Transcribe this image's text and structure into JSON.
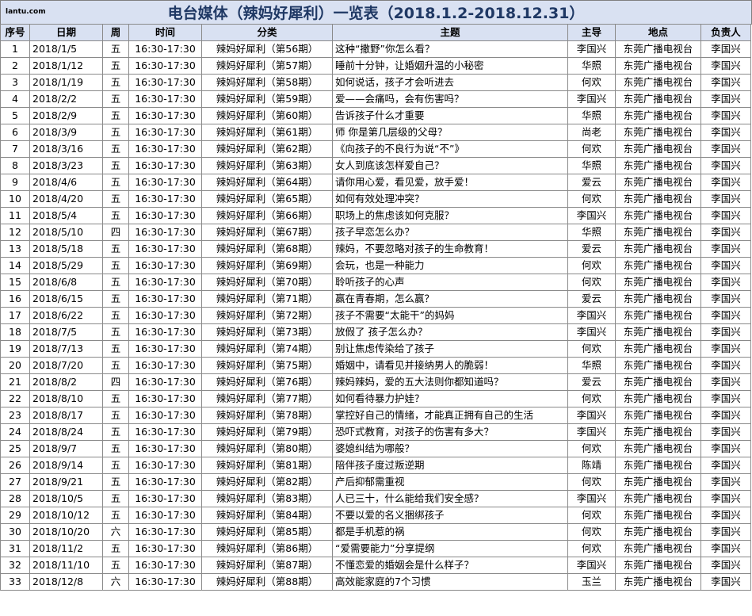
{
  "logo": "lantu.com",
  "title": "电台媒体（辣妈好犀利）一览表（2018.1.2-2018.12.31）",
  "columns": [
    "序号",
    "日期",
    "周",
    "时间",
    "分类",
    "主题",
    "主导",
    "地点",
    "负责人"
  ],
  "rows": [
    [
      "1",
      "2018/1/5",
      "五",
      "16:30-17:30",
      "辣妈好犀利（第56期）",
      "这种“撒野”你怎么看？",
      "李国兴",
      "东莞广播电视台",
      "李国兴"
    ],
    [
      "2",
      "2018/1/12",
      "五",
      "16:30-17:30",
      "辣妈好犀利（第57期）",
      "睡前十分钟，让婚姻升温的小秘密",
      "华照",
      "东莞广播电视台",
      "李国兴"
    ],
    [
      "3",
      "2018/1/19",
      "五",
      "16:30-17:30",
      "辣妈好犀利（第58期）",
      "如何说话，孩子才会听进去",
      "何欢",
      "东莞广播电视台",
      "李国兴"
    ],
    [
      "4",
      "2018/2/2",
      "五",
      "16:30-17:30",
      "辣妈好犀利（第59期）",
      "爱——会痛吗，会有伤害吗？",
      "李国兴",
      "东莞广播电视台",
      "李国兴"
    ],
    [
      "5",
      "2018/2/9",
      "五",
      "16:30-17:30",
      "辣妈好犀利（第60期）",
      "告诉孩子什么才重要",
      "华照",
      "东莞广播电视台",
      "李国兴"
    ],
    [
      "6",
      "2018/3/9",
      "五",
      "16:30-17:30",
      "辣妈好犀利（第61期）",
      "师 你是第几层级的父母？",
      "尚老",
      "东莞广播电视台",
      "李国兴"
    ],
    [
      "7",
      "2018/3/16",
      "五",
      "16:30-17:30",
      "辣妈好犀利（第62期）",
      "《向孩子的不良行为说“不”》",
      "何欢",
      "东莞广播电视台",
      "李国兴"
    ],
    [
      "8",
      "2018/3/23",
      "五",
      "16:30-17:30",
      "辣妈好犀利（第63期）",
      "女人到底该怎样爱自己？",
      "华照",
      "东莞广播电视台",
      "李国兴"
    ],
    [
      "9",
      "2018/4/6",
      "五",
      "16:30-17:30",
      "辣妈好犀利（第64期）",
      "请你用心爱，看见爱，放手爱！",
      "爱云",
      "东莞广播电视台",
      "李国兴"
    ],
    [
      "10",
      "2018/4/20",
      "五",
      "16:30-17:30",
      "辣妈好犀利（第65期）",
      "如何有效处理冲突？",
      "何欢",
      "东莞广播电视台",
      "李国兴"
    ],
    [
      "11",
      "2018/5/4",
      "五",
      "16:30-17:30",
      "辣妈好犀利（第66期）",
      "职场上的焦虑该如何克服？",
      "李国兴",
      "东莞广播电视台",
      "李国兴"
    ],
    [
      "12",
      "2018/5/10",
      "四",
      "16:30-17:30",
      "辣妈好犀利（第67期）",
      "孩子早恋怎么办？",
      "华照",
      "东莞广播电视台",
      "李国兴"
    ],
    [
      "13",
      "2018/5/18",
      "五",
      "16:30-17:30",
      "辣妈好犀利（第68期）",
      "辣妈，不要忽略对孩子的生命教育！",
      "爱云",
      "东莞广播电视台",
      "李国兴"
    ],
    [
      "14",
      "2018/5/29",
      "五",
      "16:30-17:30",
      "辣妈好犀利（第69期）",
      "会玩，也是一种能力",
      "何欢",
      "东莞广播电视台",
      "李国兴"
    ],
    [
      "15",
      "2018/6/8",
      "五",
      "16:30-17:30",
      "辣妈好犀利（第70期）",
      "聆听孩子的心声",
      "何欢",
      "东莞广播电视台",
      "李国兴"
    ],
    [
      "16",
      "2018/6/15",
      "五",
      "16:30-17:30",
      "辣妈好犀利（第71期）",
      "赢在青春期，怎么赢？",
      "爱云",
      "东莞广播电视台",
      "李国兴"
    ],
    [
      "17",
      "2018/6/22",
      "五",
      "16:30-17:30",
      "辣妈好犀利（第72期）",
      "孩子不需要“太能干”的妈妈",
      "李国兴",
      "东莞广播电视台",
      "李国兴"
    ],
    [
      "18",
      "2018/7/5",
      "五",
      "16:30-17:30",
      "辣妈好犀利（第73期）",
      "放假了 孩子怎么办？",
      "李国兴",
      "东莞广播电视台",
      "李国兴"
    ],
    [
      "19",
      "2018/7/13",
      "五",
      "16:30-17:30",
      "辣妈好犀利（第74期）",
      "别让焦虑传染给了孩子",
      "何欢",
      "东莞广播电视台",
      "李国兴"
    ],
    [
      "20",
      "2018/7/20",
      "五",
      "16:30-17:30",
      "辣妈好犀利（第75期）",
      "婚姻中，请看见并接纳男人的脆弱！",
      "华照",
      "东莞广播电视台",
      "李国兴"
    ],
    [
      "21",
      "2018/8/2",
      "四",
      "16:30-17:30",
      "辣妈好犀利（第76期）",
      "辣妈辣妈，爱的五大法则你都知道吗？",
      "爱云",
      "东莞广播电视台",
      "李国兴"
    ],
    [
      "22",
      "2018/8/10",
      "五",
      "16:30-17:30",
      "辣妈好犀利（第77期）",
      "如何看待暴力护娃？",
      "何欢",
      "东莞广播电视台",
      "李国兴"
    ],
    [
      "23",
      "2018/8/17",
      "五",
      "16:30-17:30",
      "辣妈好犀利（第78期）",
      "掌控好自己的情绪，才能真正拥有自己的生活",
      "李国兴",
      "东莞广播电视台",
      "李国兴"
    ],
    [
      "24",
      "2018/8/24",
      "五",
      "16:30-17:30",
      "辣妈好犀利（第79期）",
      "恐吓式教育，对孩子的伤害有多大？",
      "李国兴",
      "东莞广播电视台",
      "李国兴"
    ],
    [
      "25",
      "2018/9/7",
      "五",
      "16:30-17:30",
      "辣妈好犀利（第80期）",
      "婆媳纠结为哪般？",
      "何欢",
      "东莞广播电视台",
      "李国兴"
    ],
    [
      "26",
      "2018/9/14",
      "五",
      "16:30-17:30",
      "辣妈好犀利（第81期）",
      "陪伴孩子度过叛逆期",
      "陈靖",
      "东莞广播电视台",
      "李国兴"
    ],
    [
      "27",
      "2018/9/21",
      "五",
      "16:30-17:30",
      "辣妈好犀利（第82期）",
      "产后抑郁需重视",
      "何欢",
      "东莞广播电视台",
      "李国兴"
    ],
    [
      "28",
      "2018/10/5",
      "五",
      "16:30-17:30",
      "辣妈好犀利（第83期）",
      "人已三十，什么能给我们安全感？",
      "李国兴",
      "东莞广播电视台",
      "李国兴"
    ],
    [
      "29",
      "2018/10/12",
      "五",
      "16:30-17:30",
      "辣妈好犀利（第84期）",
      "不要以爱的名义捆绑孩子",
      "何欢",
      "东莞广播电视台",
      "李国兴"
    ],
    [
      "30",
      "2018/10/20",
      "六",
      "16:30-17:30",
      "辣妈好犀利（第85期）",
      "都是手机惹的祸",
      "何欢",
      "东莞广播电视台",
      "李国兴"
    ],
    [
      "31",
      "2018/11/2",
      "五",
      "16:30-17:30",
      "辣妈好犀利（第86期）",
      "“爱需要能力”分享提纲",
      "何欢",
      "东莞广播电视台",
      "李国兴"
    ],
    [
      "32",
      "2018/11/10",
      "五",
      "16:30-17:30",
      "辣妈好犀利（第87期）",
      "不懂恋爱的婚姻会是什么样子？",
      "李国兴",
      "东莞广播电视台",
      "李国兴"
    ],
    [
      "33",
      "2018/12/8",
      "六",
      "16:30-17:30",
      "辣妈好犀利（第88期）",
      "高效能家庭的7个习惯",
      "玉兰",
      "东莞广播电视台",
      "李国兴"
    ]
  ]
}
